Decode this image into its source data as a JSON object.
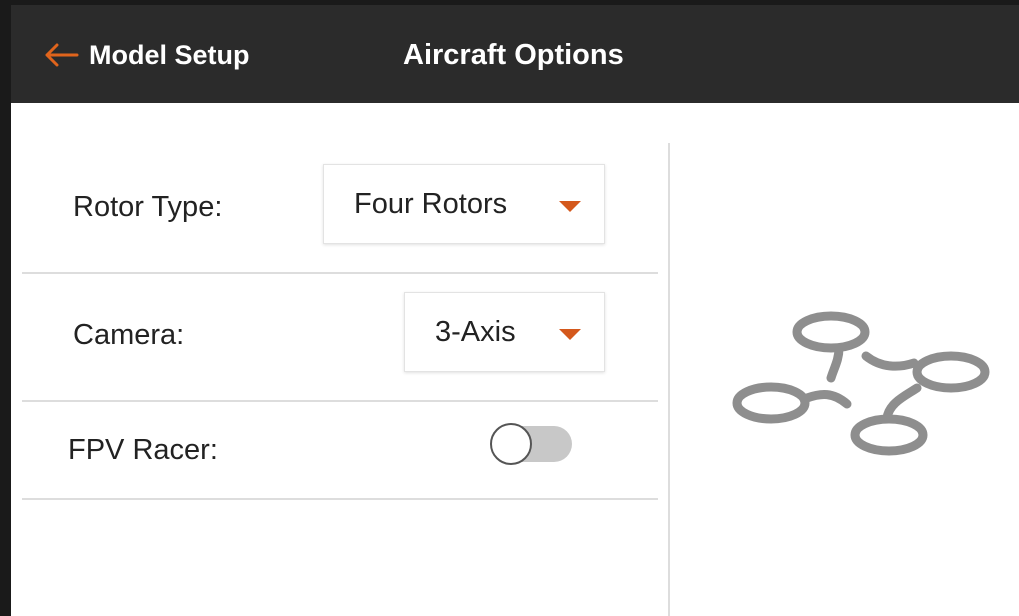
{
  "header": {
    "back_label": "Model Setup",
    "title": "Aircraft Options",
    "accent": "#e0641c"
  },
  "options": {
    "rotor_type": {
      "label": "Rotor Type:",
      "value": "Four Rotors"
    },
    "camera": {
      "label": "Camera:",
      "value": "3-Axis"
    },
    "fpv_racer": {
      "label": "FPV Racer:",
      "enabled": false
    }
  },
  "preview": {
    "icon": "quadcopter-icon"
  },
  "colors": {
    "header_bg": "#2b2b2b",
    "caret": "#d4581c",
    "divider": "#dddddd",
    "icon_gray": "#8e8e8e"
  }
}
